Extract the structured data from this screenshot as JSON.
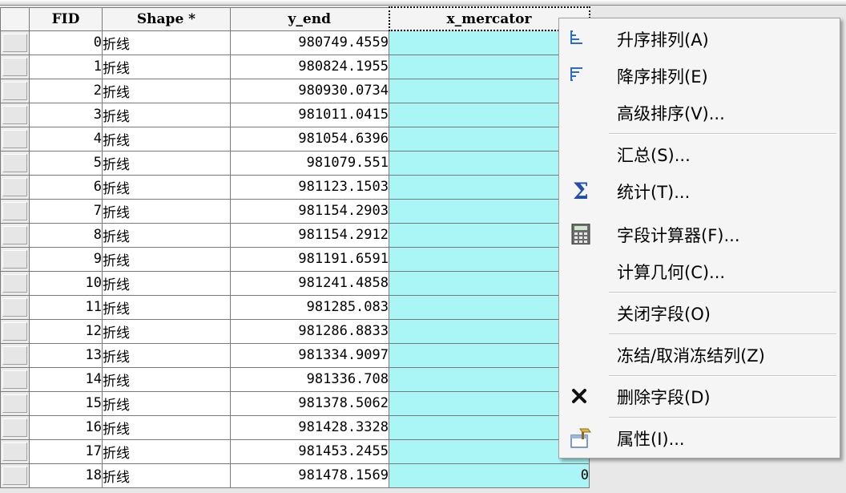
{
  "table": {
    "columns": [
      "",
      "FID",
      "Shape *",
      "y_end",
      "x_mercator"
    ],
    "rows": [
      {
        "fid": "0",
        "shape": "折线",
        "y_end": "980749.4559",
        "x_mercator": ""
      },
      {
        "fid": "1",
        "shape": "折线",
        "y_end": "980824.1955",
        "x_mercator": ""
      },
      {
        "fid": "2",
        "shape": "折线",
        "y_end": "980930.0734",
        "x_mercator": ""
      },
      {
        "fid": "3",
        "shape": "折线",
        "y_end": "981011.0415",
        "x_mercator": ""
      },
      {
        "fid": "4",
        "shape": "折线",
        "y_end": "981054.6396",
        "x_mercator": ""
      },
      {
        "fid": "5",
        "shape": "折线",
        "y_end": "981079.551",
        "x_mercator": ""
      },
      {
        "fid": "6",
        "shape": "折线",
        "y_end": "981123.1503",
        "x_mercator": ""
      },
      {
        "fid": "7",
        "shape": "折线",
        "y_end": "981154.2903",
        "x_mercator": ""
      },
      {
        "fid": "8",
        "shape": "折线",
        "y_end": "981154.2912",
        "x_mercator": ""
      },
      {
        "fid": "9",
        "shape": "折线",
        "y_end": "981191.6591",
        "x_mercator": ""
      },
      {
        "fid": "10",
        "shape": "折线",
        "y_end": "981241.4858",
        "x_mercator": ""
      },
      {
        "fid": "11",
        "shape": "折线",
        "y_end": "981285.083",
        "x_mercator": ""
      },
      {
        "fid": "12",
        "shape": "折线",
        "y_end": "981286.8833",
        "x_mercator": ""
      },
      {
        "fid": "13",
        "shape": "折线",
        "y_end": "981334.9097",
        "x_mercator": ""
      },
      {
        "fid": "14",
        "shape": "折线",
        "y_end": "981336.708",
        "x_mercator": ""
      },
      {
        "fid": "15",
        "shape": "折线",
        "y_end": "981378.5062",
        "x_mercator": ""
      },
      {
        "fid": "16",
        "shape": "折线",
        "y_end": "981428.3328",
        "x_mercator": ""
      },
      {
        "fid": "17",
        "shape": "折线",
        "y_end": "981453.2455",
        "x_mercator": ""
      },
      {
        "fid": "18",
        "shape": "折线",
        "y_end": "981478.1569",
        "x_mercator": "0"
      }
    ]
  },
  "context_menu": {
    "items": [
      {
        "label": "升序排列(A)",
        "icon": "sort-ascending-icon"
      },
      {
        "label": "降序排列(E)",
        "icon": "sort-descending-icon"
      },
      {
        "label": "高级排序(V)...",
        "icon": ""
      },
      {
        "label": "汇总(S)...",
        "icon": ""
      },
      {
        "label": "统计(T)...",
        "icon": "sigma-statistics-icon"
      },
      {
        "label": "字段计算器(F)...",
        "icon": "calculator-icon"
      },
      {
        "label": "计算几何(C)...",
        "icon": ""
      },
      {
        "label": "关闭字段(O)",
        "icon": ""
      },
      {
        "label": "冻结/取消冻结列(Z)",
        "icon": ""
      },
      {
        "label": "删除字段(D)",
        "icon": "delete-x-icon"
      },
      {
        "label": "属性(I)...",
        "icon": "properties-icon"
      }
    ]
  },
  "colors": {
    "selected_column": "#aaf5f5",
    "menu_bg": "#f5f5f5"
  }
}
